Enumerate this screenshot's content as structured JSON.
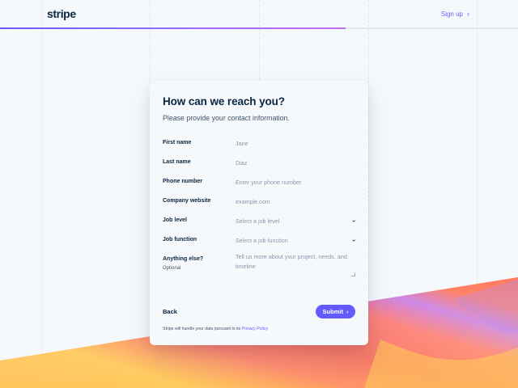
{
  "brand": {
    "logo": "stripe",
    "accent_color": "#635bff",
    "text_color": "#0a2540"
  },
  "header": {
    "signup_label": "Sign up",
    "signup_icon": "chevron-right-icon",
    "progress_fraction": 0.667
  },
  "form": {
    "title": "How can we reach you?",
    "subtitle": "Please provide your contact information.",
    "fields": {
      "first_name": {
        "label": "First name",
        "placeholder": "Jane",
        "value": ""
      },
      "last_name": {
        "label": "Last name",
        "placeholder": "Diaz",
        "value": ""
      },
      "phone": {
        "label": "Phone number",
        "placeholder": "Enter your phone number",
        "value": ""
      },
      "website": {
        "label": "Company website",
        "placeholder": "example.com",
        "value": ""
      },
      "job_level": {
        "label": "Job level",
        "selected": "Select a job level"
      },
      "job_function": {
        "label": "Job function",
        "selected": "Select a job function"
      },
      "anything_else": {
        "label": "Anything else?",
        "note": "Optional",
        "placeholder": "Tell us more about your project, needs, and timeline"
      }
    },
    "back_label": "Back",
    "submit_label": "Submit",
    "privacy_text": "Stripe will handle your data pursuant to its",
    "privacy_link": "Privacy Policy"
  }
}
